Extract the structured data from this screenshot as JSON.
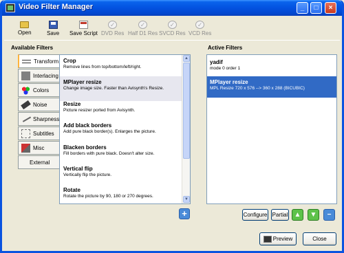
{
  "window": {
    "title": "Video Filter Manager"
  },
  "toolbar": {
    "open": "Open",
    "save": "Save",
    "save_script": "Save Script",
    "dvd_res": "DVD Res",
    "half_d1_res": "Half D1 Res",
    "svcd_res": "SVCD Res",
    "vcd_res": "VCD Res"
  },
  "available": {
    "heading": "Available Filters",
    "tabs": [
      "Transform",
      "Interlacing",
      "Colors",
      "Noise",
      "Sharpness",
      "Subtitles",
      "Misc",
      "External"
    ],
    "items": [
      {
        "name": "Crop",
        "desc": "Remove lines from top/bottom/left/right."
      },
      {
        "name": "MPlayer resize",
        "desc": "Change image size. Faster than Avisynth's Resize."
      },
      {
        "name": "Resize",
        "desc": "Picture resizer ported from Avisynth."
      },
      {
        "name": "Add black borders",
        "desc": "Add pure black border(s). Enlarges the picture."
      },
      {
        "name": "Blacken borders",
        "desc": "Fill borders with pure black. Doesn't alter size."
      },
      {
        "name": "Vertical flip",
        "desc": "Vertically flip the picture."
      },
      {
        "name": "Rotate",
        "desc": "Rotate the picture by 90, 180 or 270 degrees."
      }
    ]
  },
  "active": {
    "heading": "Active Filters",
    "items": [
      {
        "name": "yadif",
        "desc": "mode 0 order 1"
      },
      {
        "name": "MPlayer resize",
        "desc": "MPL Resize 720 x 576 --> 360 x 288 (BICUBIC)"
      }
    ]
  },
  "buttons": {
    "configure": "Configure",
    "partial": "Partial",
    "preview": "Preview",
    "close": "Close",
    "add": "+",
    "up": "▲",
    "down": "▼",
    "remove": "−"
  },
  "colors": {
    "titlebar": "#0352e0",
    "selection": "#316ac5",
    "highlight_item": "#e7e7ef"
  }
}
